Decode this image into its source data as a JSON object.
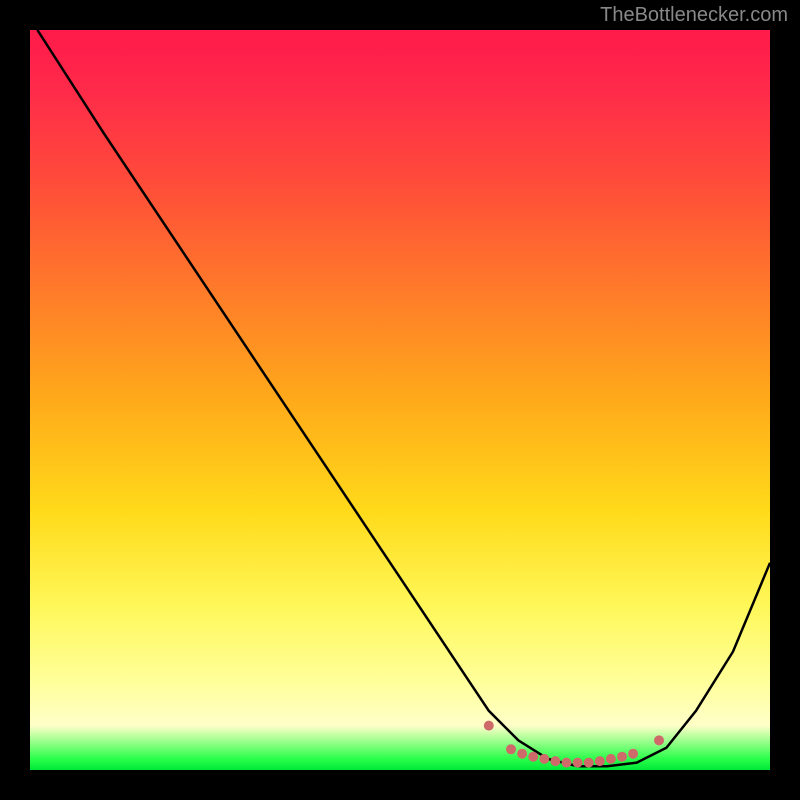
{
  "watermark": "TheBottlenecker.com",
  "chart_data": {
    "type": "line",
    "title": "",
    "xlabel": "",
    "ylabel": "",
    "xlim": [
      0,
      100
    ],
    "ylim": [
      0,
      100
    ],
    "background_gradient": {
      "description": "vertical gradient from red (top, high bottleneck) through orange and yellow to green (bottom, no bottleneck)",
      "stops": [
        {
          "pos": 0,
          "color": "#ff1a4a"
        },
        {
          "pos": 50,
          "color": "#ffaa1a"
        },
        {
          "pos": 88,
          "color": "#ffff9a"
        },
        {
          "pos": 100,
          "color": "#00e838"
        }
      ]
    },
    "series": [
      {
        "name": "bottleneck-curve",
        "color": "#000000",
        "x": [
          1,
          10,
          20,
          30,
          40,
          50,
          58,
          62,
          66,
          70,
          74,
          78,
          82,
          86,
          90,
          95,
          100
        ],
        "y": [
          100,
          86,
          71,
          56,
          41,
          26,
          14,
          8,
          4,
          1.5,
          0.5,
          0.5,
          1,
          3,
          8,
          16,
          28
        ]
      }
    ],
    "markers": {
      "name": "optimal-range-dots",
      "color": "#cf6a6a",
      "x": [
        62,
        65,
        66.5,
        68,
        69.5,
        71,
        72.5,
        74,
        75.5,
        77,
        78.5,
        80,
        81.5,
        85
      ],
      "y": [
        6,
        2.8,
        2.2,
        1.8,
        1.5,
        1.2,
        1.0,
        1.0,
        1.0,
        1.2,
        1.5,
        1.8,
        2.2,
        4
      ]
    }
  }
}
